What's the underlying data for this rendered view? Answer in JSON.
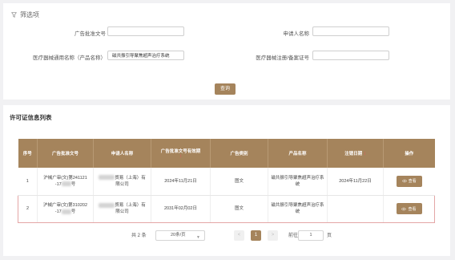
{
  "filter": {
    "title": "筛选项",
    "fields": {
      "approval_no": {
        "label": "广告批准文号",
        "value": ""
      },
      "applicant": {
        "label": "申请人名称",
        "value": ""
      },
      "device_name": {
        "label": "医疗器械通用名称（产品名称）",
        "value": "磁共振引导聚焦超声治疗系统"
      },
      "device_reg_no": {
        "label": "医疗器械注册/备案证号",
        "value": ""
      }
    },
    "query_label": "查询"
  },
  "list": {
    "title": "许可证信息列表",
    "columns": [
      "序号",
      "广告批准文号",
      "申请人名称",
      "广告批准文号有效期",
      "广告类别",
      "产品名称",
      "注销日期",
      "操作"
    ],
    "sort_mark": "↕",
    "rows": [
      {
        "index": "1",
        "approval_no_a": "沪械广审(文)第241121",
        "approval_no_b": "-17",
        "approval_no_c": "号",
        "applicant_a": "贸易（上海）有",
        "applicant_b": "限公司",
        "validity": "2024年11月21日",
        "category": "图文",
        "product": "磁共振引导聚焦超声治疗系统",
        "cancel_date": "2024年11月22日",
        "action": "查看"
      },
      {
        "index": "2",
        "approval_no_a": "沪械广审(文)第310202",
        "approval_no_b": "-17",
        "approval_no_c": "号",
        "applicant_a": "贸易（上海）有",
        "applicant_b": "限公司",
        "validity": "2031年02月02日",
        "category": "图文",
        "product": "磁共振引导聚焦超声治疗系统",
        "cancel_date": "",
        "action": "查看"
      }
    ]
  },
  "pager": {
    "total": "共 2 条",
    "page_size": "20条/页",
    "prev": "<",
    "current": "1",
    "next": ">",
    "goto_label": "前往",
    "goto_value": "1",
    "goto_suffix": "页"
  },
  "colors": {
    "accent": "#a5845c",
    "highlight_border": "#e4a6a6",
    "sort_mark": "#e25b5b"
  },
  "icons": {
    "filter": "funnel-icon",
    "view": "eye-icon",
    "dropdown": "chevron-down-icon"
  }
}
